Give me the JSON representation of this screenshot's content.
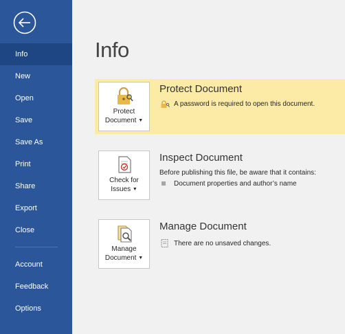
{
  "sidebar": {
    "items": [
      {
        "label": "Info",
        "active": true
      },
      {
        "label": "New"
      },
      {
        "label": "Open"
      },
      {
        "label": "Save"
      },
      {
        "label": "Save As"
      },
      {
        "label": "Print"
      },
      {
        "label": "Share"
      },
      {
        "label": "Export"
      },
      {
        "label": "Close"
      },
      {
        "label": "Account"
      },
      {
        "label": "Feedback"
      },
      {
        "label": "Options"
      }
    ],
    "bg_color": "#2b579a",
    "active_color": "#1e4682"
  },
  "main": {
    "title": "Info",
    "protect": {
      "tile_line1": "Protect",
      "tile_line2": "Document",
      "title": "Protect Document",
      "message": "A password is required to open this document.",
      "highlight_color": "#fbeba6"
    },
    "inspect": {
      "tile_line1": "Check for",
      "tile_line2": "Issues",
      "title": "Inspect Document",
      "intro": "Before publishing this file, be aware that it contains:",
      "bullet": "Document properties and author’s name"
    },
    "manage": {
      "tile_line1": "Manage",
      "tile_line2": "Document",
      "title": "Manage Document",
      "message": "There are no unsaved changes."
    }
  }
}
